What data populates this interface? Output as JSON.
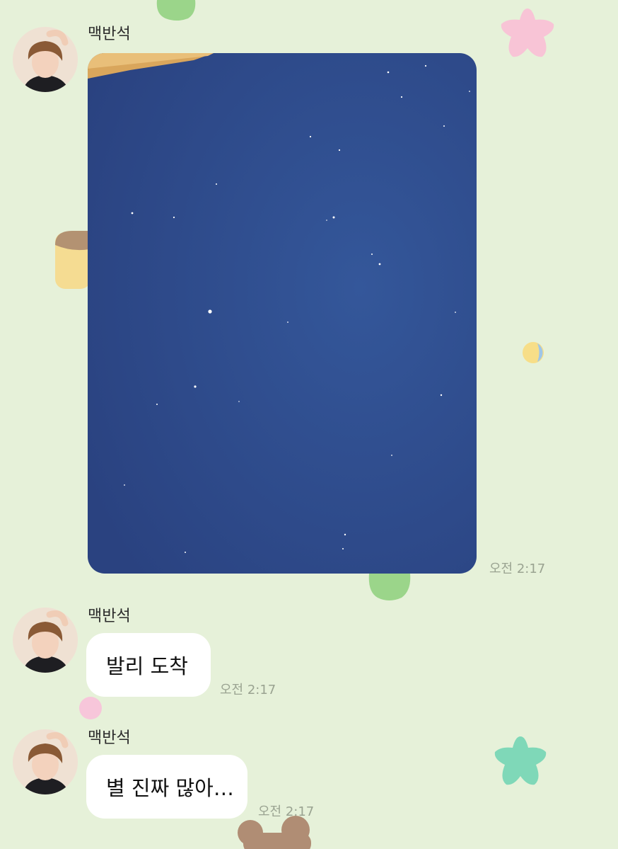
{
  "colors": {
    "background": "#e6f1d9",
    "bubble": "#ffffff",
    "sky_photo": "#2f4a88",
    "timestamp": "#9aa391"
  },
  "messages": [
    {
      "sender": "맥반석",
      "type": "image",
      "image_desc_icon": "night-sky-photo",
      "time": "오전 2:17"
    },
    {
      "sender": "맥반석",
      "type": "text",
      "text": "발리 도착",
      "time": "오전 2:17"
    },
    {
      "sender": "맥반석",
      "type": "text",
      "text": "별 진짜 많아…",
      "time": "오전 2:17"
    }
  ]
}
